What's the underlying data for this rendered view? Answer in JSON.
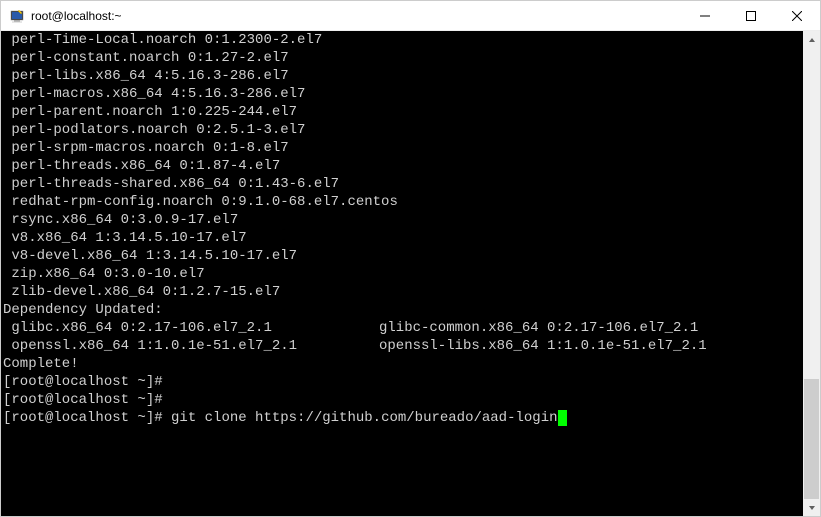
{
  "titlebar": {
    "title": "root@localhost:~"
  },
  "terminal": {
    "lines": {
      "l0": " perl-Time-Local.noarch 0:1.2300-2.el7",
      "l1": " perl-constant.noarch 0:1.27-2.el7",
      "l2": " perl-libs.x86_64 4:5.16.3-286.el7",
      "l3": " perl-macros.x86_64 4:5.16.3-286.el7",
      "l4": " perl-parent.noarch 1:0.225-244.el7",
      "l5": " perl-podlators.noarch 0:2.5.1-3.el7",
      "l6": " perl-srpm-macros.noarch 0:1-8.el7",
      "l7": " perl-threads.x86_64 0:1.87-4.el7",
      "l8": " perl-threads-shared.x86_64 0:1.43-6.el7",
      "l9": " redhat-rpm-config.noarch 0:9.1.0-68.el7.centos",
      "l10": " rsync.x86_64 0:3.0.9-17.el7",
      "l11": " v8.x86_64 1:3.14.5.10-17.el7",
      "l12": " v8-devel.x86_64 1:3.14.5.10-17.el7",
      "l13": " zip.x86_64 0:3.0-10.el7",
      "l14": " zlib-devel.x86_64 0:1.2.7-15.el7",
      "l15": "",
      "l16": "Dependency Updated:",
      "l17a": " glibc.x86_64 0:2.17-106.el7_2.1",
      "l17b": "glibc-common.x86_64 0:2.17-106.el7_2.1",
      "l18a": " openssl.x86_64 1:1.0.1e-51.el7_2.1",
      "l18b": "openssl-libs.x86_64 1:1.0.1e-51.el7_2.1",
      "l19": "",
      "l20": "Complete!",
      "l21": "[root@localhost ~]#",
      "l22": "[root@localhost ~]#",
      "l23prompt": "[root@localhost ~]# ",
      "l23cmd": "git clone https://github.com/bureado/aad-login"
    }
  }
}
